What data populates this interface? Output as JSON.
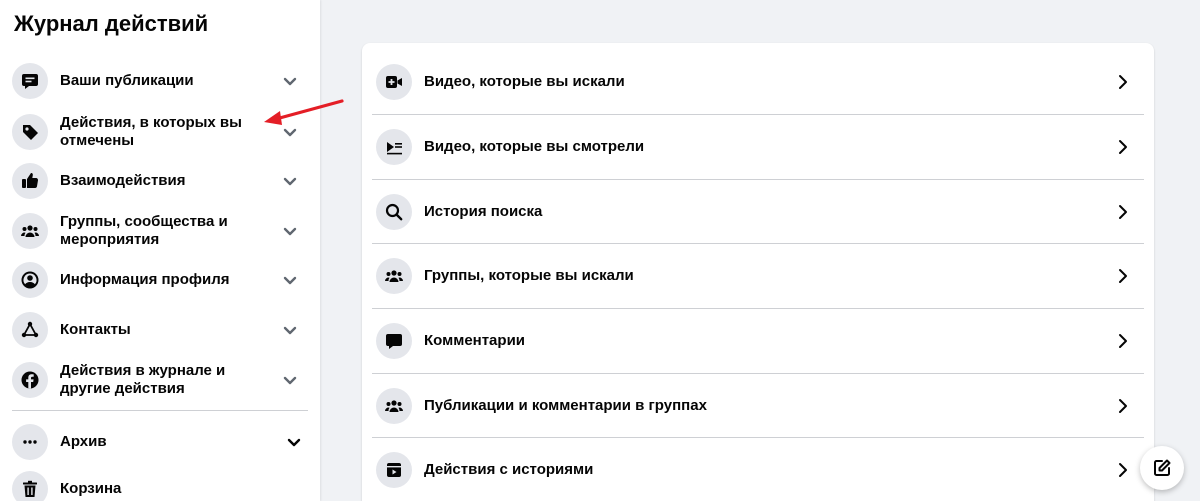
{
  "sidebar": {
    "title": "Журнал действий",
    "items": [
      {
        "label": "Ваши публикации",
        "icon": "speech-bubble-icon"
      },
      {
        "label": "Действия, в которых вы отмечены",
        "icon": "tag-icon"
      },
      {
        "label": "Взаимодействия",
        "icon": "thumbs-up-icon"
      },
      {
        "label": "Группы, сообщества и мероприятия",
        "icon": "people-icon"
      },
      {
        "label": "Информация профиля",
        "icon": "profile-circle-icon"
      },
      {
        "label": "Контакты",
        "icon": "connections-icon"
      },
      {
        "label": "Действия в журнале и другие действия",
        "icon": "facebook-icon"
      }
    ],
    "archive_label": "Архив",
    "trash_label": "Корзина"
  },
  "main": {
    "rows": [
      {
        "label": "Видео, которые вы искали",
        "icon": "video-search-icon"
      },
      {
        "label": "Видео, которые вы смотрели",
        "icon": "video-list-icon"
      },
      {
        "label": "История поиска",
        "icon": "search-icon"
      },
      {
        "label": "Группы, которые вы искали",
        "icon": "people-icon"
      },
      {
        "label": "Комментарии",
        "icon": "comment-icon"
      },
      {
        "label": "Публикации и комментарии в группах",
        "icon": "people-icon"
      },
      {
        "label": "Действия с историями",
        "icon": "stories-icon"
      }
    ]
  },
  "colors": {
    "background": "#f0f2f5",
    "card": "#ffffff",
    "icon_bg": "#e4e6eb",
    "annotation_arrow": "#e41e26"
  }
}
